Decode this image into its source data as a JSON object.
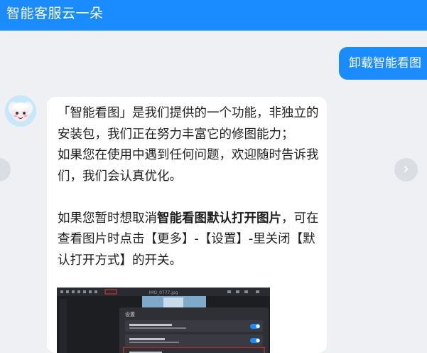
{
  "header": {
    "title": "智能客服云一朵"
  },
  "user_message": {
    "text": "卸载智能看图"
  },
  "bot_message": {
    "paragraph1": "「智能看图」是我们提供的一个功能，非独立的安装包，我们正在努力丰富它的修图能力；",
    "paragraph2": "如果您在使用中遇到任何问题，欢迎随时告诉我们，我们会认真优化。",
    "paragraph3_prefix": "如果您暂时想取消",
    "paragraph3_bold": "智能看图默认打开图片",
    "paragraph3_suffix": "，可在查看图片时点击【更多】-【设置】-里关闭【默认打开方式】的开关。"
  },
  "screenshot": {
    "dialog_title": "设置",
    "file_name": "IMG_0777.jpg"
  },
  "colors": {
    "accent": "#1a8cff",
    "background": "#eef0f3",
    "bubble": "#ffffff"
  }
}
